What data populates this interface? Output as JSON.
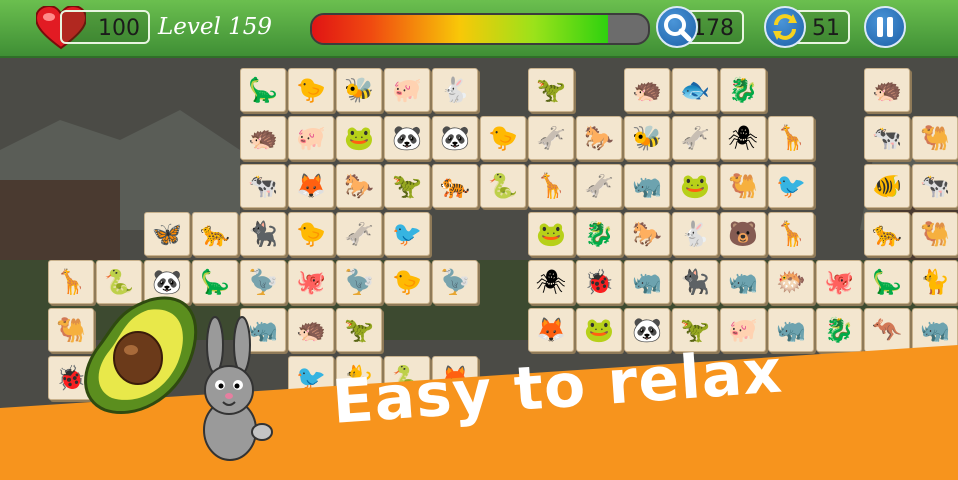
{
  "hud": {
    "lives": "100",
    "level_label": "Level 159",
    "progress_fraction": 0.88,
    "hints": "178",
    "shuffles": "51"
  },
  "colors": {
    "banner": "#f7941d",
    "hud_green": "#4fa63f",
    "tile": "#f3e6cf"
  },
  "tiles": [
    [
      "",
      "",
      "",
      "",
      "dino-blue",
      "chick",
      "bee",
      "pig",
      "rabbit",
      "",
      "dino-green",
      "",
      "hedgehog",
      "fish-purple",
      "seahorse",
      "",
      "",
      "hedgehog",
      ""
    ],
    [
      "",
      "",
      "",
      "",
      "hedgehog",
      "pig",
      "frog",
      "panda",
      "panda",
      "chick",
      "donkey",
      "horse",
      "bee",
      "donkey",
      "spider",
      "giraffe",
      "",
      "cow",
      "camel"
    ],
    [
      "",
      "",
      "",
      "",
      "cow",
      "fox",
      "horse",
      "dino-green",
      "tiger",
      "snake",
      "giraffe",
      "donkey",
      "rhino",
      "frog",
      "camel",
      "toucan",
      "",
      "fish-orange",
      "cow"
    ],
    [
      "",
      "",
      "dragonfly",
      "leopard",
      "panther",
      "chick",
      "donkey",
      "toucan",
      "",
      "",
      "frog",
      "seahorse",
      "horse",
      "rabbit",
      "bear",
      "giraffe",
      "",
      "leopard",
      "camel"
    ],
    [
      "giraffe",
      "snake",
      "panda",
      "dino-blue",
      "ostrich",
      "octopus",
      "ostrich",
      "chick",
      "ostrich",
      "",
      "spider",
      "ladybug",
      "rhino",
      "panther",
      "rhino",
      "pufferfish",
      "octopus",
      "dino-blue",
      "cat"
    ],
    [
      "camel",
      "",
      "",
      "",
      "rhino",
      "hedgehog",
      "dino-green",
      "",
      "",
      "",
      "fox",
      "frog",
      "panda",
      "dino-orange",
      "pig",
      "rhino",
      "seahorse",
      "kangaroo",
      "rhino"
    ],
    [
      "ladybug",
      "",
      "",
      "",
      "",
      "toucan",
      "cat",
      "snake",
      "fox",
      "",
      "",
      "",
      "",
      "",
      "",
      "",
      "",
      "",
      ""
    ]
  ],
  "slogan": "Easy to relax"
}
